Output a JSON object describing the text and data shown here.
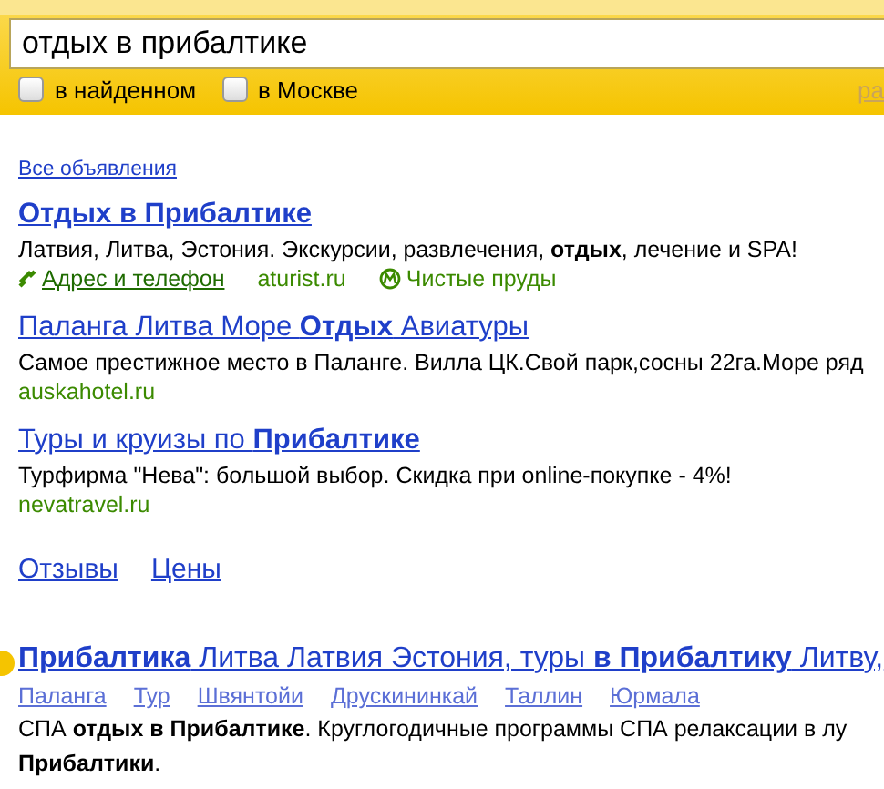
{
  "search": {
    "value": "отдых в прибалтике",
    "options": [
      {
        "label": "в найденном",
        "checked": false
      },
      {
        "label": "в Москве",
        "checked": false
      }
    ],
    "link": "ра"
  },
  "ads_header": "Все объявления",
  "ads": [
    {
      "title": "Отдых в Прибалтике",
      "description": "Латвия, Литва, Эстония. Экскурсии, развлечения, **отдых**, лечение и SPA!",
      "contact": "Адрес и телефон",
      "url": "aturist.ru",
      "metro": "Чистые пруды"
    },
    {
      "title": "Паланга Литва Море **Отдых** Авиатуры",
      "description": "Самое престижное место в Паланге. Вилла ЦК.Свой парк,сосны 22га.Море ряд",
      "url": "auskahotel.ru"
    },
    {
      "title": "Туры и круизы по **Прибалтике**",
      "description": "Турфирма \"Нева\": большой выбор. Скидка при online-покупке - 4%!",
      "url": "nevatravel.ru"
    }
  ],
  "ad_links": [
    "Отзывы",
    "Цены"
  ],
  "result": {
    "title": "**Прибалтика** Литва Латвия Эстония, туры **в Прибалтику** Литву,",
    "sitelinks": [
      "Паланга",
      "Тур",
      "Швянтойи",
      "Друскининкай",
      "Таллин",
      "Юрмала"
    ],
    "snippet": [
      "СПА **отдых в Прибалтике**. Круглогодичные программы СПА релаксации в лу",
      "**Прибалтики**."
    ]
  }
}
